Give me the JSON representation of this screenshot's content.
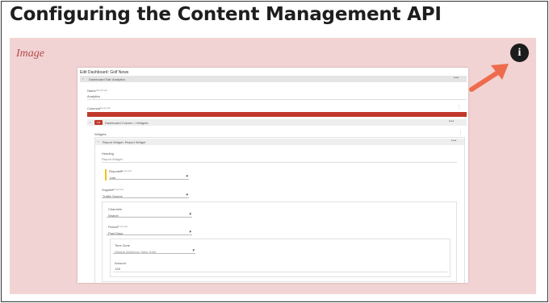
{
  "page": {
    "title": "Configuring the Content Management API"
  },
  "image_panel": {
    "label": "Image"
  },
  "icons": {
    "info": "info-icon",
    "arrow": "arrow-icon",
    "info_glyph": "i"
  },
  "colors": {
    "panel_bg": "#f2d3d3",
    "arrow": "#ee6c4d",
    "accent_red": "#c0392b"
  },
  "screenshot": {
    "title": "Edit Dashboard: Golf News",
    "tab_bar": "Dashboard Tab: Analytics",
    "name_label": "Name",
    "name_req": "(Required)",
    "name_value": "Analytics",
    "columns_label": "Columns",
    "columns_req": "(Required)",
    "column_badge": "1/2",
    "column_bar": "Dashboard Column > Widgets",
    "widgets_label": "Widgets",
    "widget_bar": "Report Widget: Report Widget",
    "heading_label": "Heading",
    "heading_value": "Report Widget",
    "reportee_label": "Reportee",
    "reportee_req": "(Required)",
    "reportee_value": "Link",
    "supplier_label": "Supplier",
    "supplier_req": "(Required)",
    "supplier_value": "Traffic Source",
    "channels_label": "Channels",
    "channels_value": "Search",
    "period_label": "Period",
    "period_req": "(Required)",
    "period_value": "Past Days",
    "timezone_label": "Time Zone",
    "timezone_value": "Default (America / New York)",
    "amount_label": "Amount",
    "amount_value": "128"
  }
}
